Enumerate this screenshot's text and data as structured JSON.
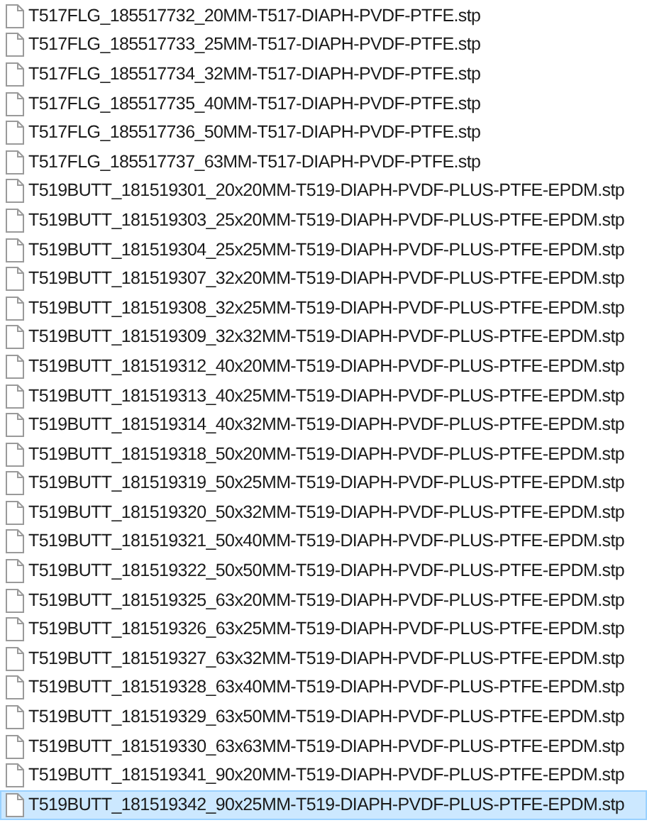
{
  "files": [
    {
      "name": "T517FLG_185517732_20MM-T517-DIAPH-PVDF-PTFE.stp",
      "selected": false
    },
    {
      "name": "T517FLG_185517733_25MM-T517-DIAPH-PVDF-PTFE.stp",
      "selected": false
    },
    {
      "name": "T517FLG_185517734_32MM-T517-DIAPH-PVDF-PTFE.stp",
      "selected": false
    },
    {
      "name": "T517FLG_185517735_40MM-T517-DIAPH-PVDF-PTFE.stp",
      "selected": false
    },
    {
      "name": "T517FLG_185517736_50MM-T517-DIAPH-PVDF-PTFE.stp",
      "selected": false
    },
    {
      "name": "T517FLG_185517737_63MM-T517-DIAPH-PVDF-PTFE.stp",
      "selected": false
    },
    {
      "name": "T519BUTT_181519301_20x20MM-T519-DIAPH-PVDF-PLUS-PTFE-EPDM.stp",
      "selected": false
    },
    {
      "name": "T519BUTT_181519303_25x20MM-T519-DIAPH-PVDF-PLUS-PTFE-EPDM.stp",
      "selected": false
    },
    {
      "name": "T519BUTT_181519304_25x25MM-T519-DIAPH-PVDF-PLUS-PTFE-EPDM.stp",
      "selected": false
    },
    {
      "name": "T519BUTT_181519307_32x20MM-T519-DIAPH-PVDF-PLUS-PTFE-EPDM.stp",
      "selected": false
    },
    {
      "name": "T519BUTT_181519308_32x25MM-T519-DIAPH-PVDF-PLUS-PTFE-EPDM.stp",
      "selected": false
    },
    {
      "name": "T519BUTT_181519309_32x32MM-T519-DIAPH-PVDF-PLUS-PTFE-EPDM.stp",
      "selected": false
    },
    {
      "name": "T519BUTT_181519312_40x20MM-T519-DIAPH-PVDF-PLUS-PTFE-EPDM.stp",
      "selected": false
    },
    {
      "name": "T519BUTT_181519313_40x25MM-T519-DIAPH-PVDF-PLUS-PTFE-EPDM.stp",
      "selected": false
    },
    {
      "name": "T519BUTT_181519314_40x32MM-T519-DIAPH-PVDF-PLUS-PTFE-EPDM.stp",
      "selected": false
    },
    {
      "name": "T519BUTT_181519318_50x20MM-T519-DIAPH-PVDF-PLUS-PTFE-EPDM.stp",
      "selected": false
    },
    {
      "name": "T519BUTT_181519319_50x25MM-T519-DIAPH-PVDF-PLUS-PTFE-EPDM.stp",
      "selected": false
    },
    {
      "name": "T519BUTT_181519320_50x32MM-T519-DIAPH-PVDF-PLUS-PTFE-EPDM.stp",
      "selected": false
    },
    {
      "name": "T519BUTT_181519321_50x40MM-T519-DIAPH-PVDF-PLUS-PTFE-EPDM.stp",
      "selected": false
    },
    {
      "name": "T519BUTT_181519322_50x50MM-T519-DIAPH-PVDF-PLUS-PTFE-EPDM.stp",
      "selected": false
    },
    {
      "name": "T519BUTT_181519325_63x20MM-T519-DIAPH-PVDF-PLUS-PTFE-EPDM.stp",
      "selected": false
    },
    {
      "name": "T519BUTT_181519326_63x25MM-T519-DIAPH-PVDF-PLUS-PTFE-EPDM.stp",
      "selected": false
    },
    {
      "name": "T519BUTT_181519327_63x32MM-T519-DIAPH-PVDF-PLUS-PTFE-EPDM.stp",
      "selected": false
    },
    {
      "name": "T519BUTT_181519328_63x40MM-T519-DIAPH-PVDF-PLUS-PTFE-EPDM.stp",
      "selected": false
    },
    {
      "name": "T519BUTT_181519329_63x50MM-T519-DIAPH-PVDF-PLUS-PTFE-EPDM.stp",
      "selected": false
    },
    {
      "name": "T519BUTT_181519330_63x63MM-T519-DIAPH-PVDF-PLUS-PTFE-EPDM.stp",
      "selected": false
    },
    {
      "name": "T519BUTT_181519341_90x20MM-T519-DIAPH-PVDF-PLUS-PTFE-EPDM.stp",
      "selected": false
    },
    {
      "name": "T519BUTT_181519342_90x25MM-T519-DIAPH-PVDF-PLUS-PTFE-EPDM.stp",
      "selected": true
    }
  ]
}
